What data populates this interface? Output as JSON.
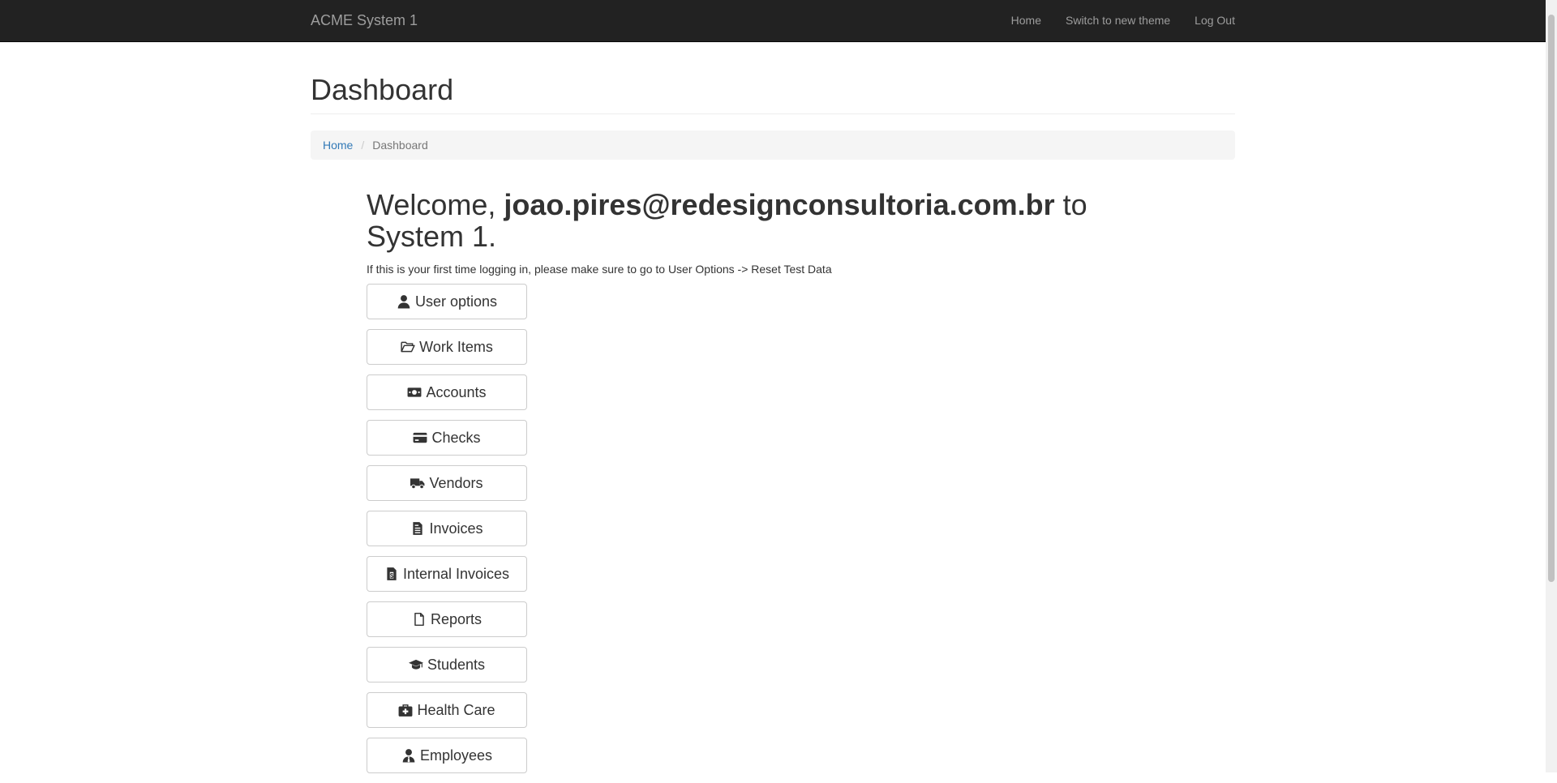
{
  "navbar": {
    "brand": "ACME System 1",
    "links": [
      {
        "label": "Home"
      },
      {
        "label": "Switch to new theme"
      },
      {
        "label": "Log Out"
      }
    ]
  },
  "page": {
    "title": "Dashboard",
    "breadcrumb": {
      "home": "Home",
      "separator": "/",
      "current": "Dashboard"
    }
  },
  "welcome": {
    "prefix": "Welcome, ",
    "user": "joao.pires@redesignconsultoria.com.br",
    "suffix": " to System 1.",
    "notice": "If this is your first time logging in, please make sure to go to User Options -> Reset Test Data"
  },
  "menu": [
    {
      "label": "User options",
      "icon": "user-icon"
    },
    {
      "label": "Work Items",
      "icon": "folder-open-icon"
    },
    {
      "label": "Accounts",
      "icon": "money-icon"
    },
    {
      "label": "Checks",
      "icon": "credit-card-icon"
    },
    {
      "label": "Vendors",
      "icon": "truck-icon"
    },
    {
      "label": "Invoices",
      "icon": "file-invoice-icon"
    },
    {
      "label": "Internal Invoices",
      "icon": "file-dollar-icon"
    },
    {
      "label": "Reports",
      "icon": "file-icon"
    },
    {
      "label": "Students",
      "icon": "graduation-cap-icon"
    },
    {
      "label": "Health Care",
      "icon": "medkit-icon"
    },
    {
      "label": "Employees",
      "icon": "user-tie-icon"
    }
  ],
  "colors": {
    "navbar_bg": "#222222",
    "link": "#337ab7",
    "text": "#333333"
  }
}
